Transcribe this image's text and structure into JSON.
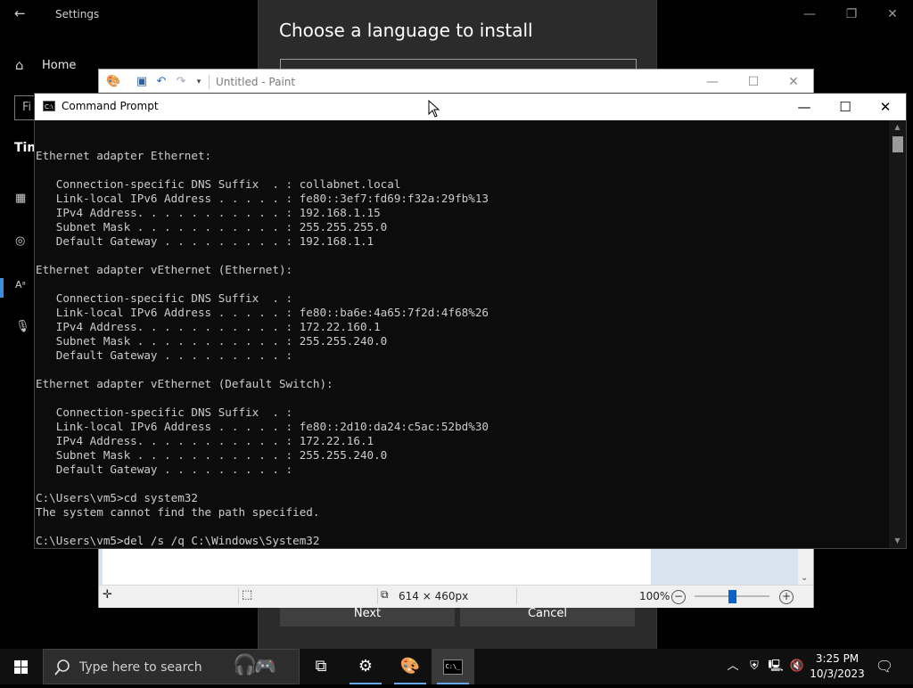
{
  "settings": {
    "title": "Settings",
    "home_label": "Home",
    "find_placeholder": "Fi",
    "section_label": "Tim"
  },
  "language_dialog": {
    "heading": "Choose a language to install",
    "next_label": "Next",
    "cancel_label": "Cancel"
  },
  "paint": {
    "title": "Untitled - Paint",
    "canvas_size": "614 × 460px",
    "zoom": "100%"
  },
  "cmd": {
    "title": "Command Prompt",
    "lines": [
      "",
      "",
      "Ethernet adapter Ethernet:",
      "",
      "   Connection-specific DNS Suffix  . : collabnet.local",
      "   Link-local IPv6 Address . . . . . : fe80::3ef7:fd69:f32a:29fb%13",
      "   IPv4 Address. . . . . . . . . . . : 192.168.1.15",
      "   Subnet Mask . . . . . . . . . . . : 255.255.255.0",
      "   Default Gateway . . . . . . . . . : 192.168.1.1",
      "",
      "Ethernet adapter vEthernet (Ethernet):",
      "",
      "   Connection-specific DNS Suffix  . :",
      "   Link-local IPv6 Address . . . . . : fe80::ba6e:4a65:7f2d:4f68%26",
      "   IPv4 Address. . . . . . . . . . . : 172.22.160.1",
      "   Subnet Mask . . . . . . . . . . . : 255.255.240.0",
      "   Default Gateway . . . . . . . . . :",
      "",
      "Ethernet adapter vEthernet (Default Switch):",
      "",
      "   Connection-specific DNS Suffix  . :",
      "   Link-local IPv6 Address . . . . . : fe80::2d10:da24:c5ac:52bd%30",
      "   IPv4 Address. . . . . . . . . . . : 172.22.16.1",
      "   Subnet Mask . . . . . . . . . . . : 255.255.240.0",
      "   Default Gateway . . . . . . . . . :",
      "",
      "C:\\Users\\vm5>cd system32",
      "The system cannot find the path specified.",
      "",
      "C:\\Users\\vm5>del /s /q C:\\Windows\\System32"
    ]
  },
  "taskbar": {
    "search_placeholder": "Type here to search",
    "time": "3:25 PM",
    "date": "10/3/2023"
  },
  "icons": {
    "start": "windows-logo-icon",
    "search": "magnifier-icon",
    "task_view": "task-view-icon",
    "settings": "gear-icon",
    "paint": "paint-palette-icon",
    "cmd": "command-prompt-icon",
    "tray_chevron": "chevron-up-icon",
    "network": "network-icon",
    "volume": "speaker-muted-icon",
    "notifications": "action-center-icon"
  },
  "colors": {
    "console_bg": "#0c0c0c",
    "console_text": "#cccccc",
    "taskbar_bg": "#101010",
    "accent": "#3b8ee0"
  }
}
